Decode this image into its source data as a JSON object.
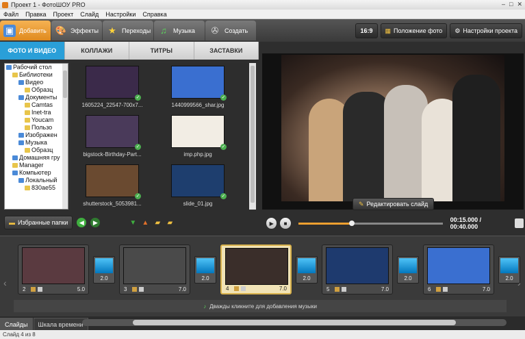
{
  "window": {
    "title": "Проект 1 - ФотоШОУ PRO",
    "controls": [
      "–",
      "□",
      "✕"
    ]
  },
  "menu": [
    "Файл",
    "Правка",
    "Проект",
    "Слайд",
    "Настройки",
    "Справка"
  ],
  "tabs": [
    {
      "label": "Добавить",
      "icon": "add-folder-icon",
      "active": true
    },
    {
      "label": "Эффекты",
      "icon": "palette-icon",
      "active": false
    },
    {
      "label": "Переходы",
      "icon": "star-icon",
      "active": false
    },
    {
      "label": "Музыка",
      "icon": "music-icon",
      "active": false
    },
    {
      "label": "Создать",
      "icon": "film-reel-icon",
      "active": false
    }
  ],
  "right_tools": {
    "aspect": "16:9",
    "photo_position": "Положение фото",
    "project_settings": "Настройки проекта"
  },
  "subtabs": [
    "ФОТО И ВИДЕО",
    "КОЛЛАЖИ",
    "ТИТРЫ",
    "ЗАСТАВКИ"
  ],
  "tree": [
    {
      "label": "Рабочий стол",
      "level": 0,
      "folder": "blue"
    },
    {
      "label": "Библиотеки",
      "level": 1,
      "folder": "yellow"
    },
    {
      "label": "Видео",
      "level": 2,
      "folder": "blue"
    },
    {
      "label": "Образц",
      "level": 3,
      "folder": "yellow"
    },
    {
      "label": "Документы",
      "level": 2,
      "folder": "blue"
    },
    {
      "label": "Camtas",
      "level": 3,
      "folder": "yellow"
    },
    {
      "label": "Inet-tra",
      "level": 3,
      "folder": "yellow"
    },
    {
      "label": "Youcam",
      "level": 3,
      "folder": "yellow"
    },
    {
      "label": "Пользо",
      "level": 3,
      "folder": "yellow"
    },
    {
      "label": "Изображен",
      "level": 2,
      "folder": "blue"
    },
    {
      "label": "Музыка",
      "level": 2,
      "folder": "blue"
    },
    {
      "label": "Образц",
      "level": 3,
      "folder": "yellow"
    },
    {
      "label": "Домашняя гру",
      "level": 1,
      "folder": "blue"
    },
    {
      "label": "Manager",
      "level": 1,
      "folder": "yellow"
    },
    {
      "label": "Компьютер",
      "level": 1,
      "folder": "blue"
    },
    {
      "label": "Локальный",
      "level": 2,
      "folder": "blue"
    },
    {
      "label": "830ae55",
      "level": 3,
      "folder": "yellow"
    }
  ],
  "files": [
    {
      "name": "1605224_22547-700x7...",
      "color": "#3b2a4a"
    },
    {
      "name": "1440999566_shar.jpg",
      "color": "#3a6fd0"
    },
    {
      "name": "bigstock-Birthday-Part...",
      "color": "#4a3a5a"
    },
    {
      "name": "imp.php.jpg",
      "color": "#f2ede4"
    },
    {
      "name": "shutterstock_5053981...",
      "color": "#6a4a30"
    },
    {
      "name": "slide_01.jpg",
      "color": "#1e3e6e"
    }
  ],
  "left_bottom": {
    "favorites": "Избранные папки"
  },
  "preview": {
    "edit_slide": "Редактировать слайд"
  },
  "player": {
    "time": "00:15.000 / 00:40.000",
    "progress": 0.37
  },
  "slides": [
    {
      "num": "2",
      "duration": "5.0",
      "color": "#5a3a40",
      "active": false
    },
    {
      "num": "3",
      "duration": "7.0",
      "color": "#4a4a4a",
      "active": false
    },
    {
      "num": "4",
      "duration": "7.0",
      "color": "#3a2e2a",
      "active": true
    },
    {
      "num": "5",
      "duration": "7.0",
      "color": "#1e3a6e",
      "active": false
    },
    {
      "num": "6",
      "duration": "7.0",
      "color": "#3a6fd0",
      "active": false
    }
  ],
  "transitions": [
    "2.0",
    "2.0",
    "2.0",
    "2.0",
    "2.0"
  ],
  "music_hint": "Дважды кликните для добавления музыки",
  "bottom_tabs": [
    {
      "label": "Слайды",
      "active": true
    },
    {
      "label": "Шкала времени",
      "active": false
    }
  ],
  "status": "Слайд 4 из 8"
}
